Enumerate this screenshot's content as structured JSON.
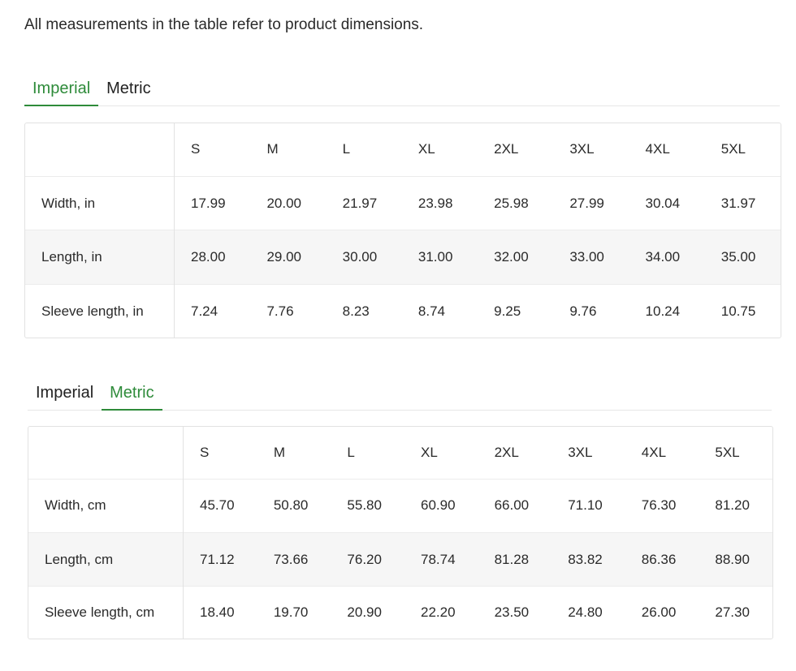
{
  "intro": "All measurements in the table refer to product dimensions.",
  "colors": {
    "accent": "#2e8b3a",
    "row_shade": "#f6f6f6",
    "border": "#e2e2e2"
  },
  "sizes": [
    "S",
    "M",
    "L",
    "XL",
    "2XL",
    "3XL",
    "4XL",
    "5XL"
  ],
  "imperial_section": {
    "tabs": [
      {
        "label": "Imperial",
        "active": true
      },
      {
        "label": "Metric",
        "active": false
      }
    ],
    "rows": [
      {
        "label": "Width, in",
        "values": [
          "17.99",
          "20.00",
          "21.97",
          "23.98",
          "25.98",
          "27.99",
          "30.04",
          "31.97"
        ]
      },
      {
        "label": "Length, in",
        "values": [
          "28.00",
          "29.00",
          "30.00",
          "31.00",
          "32.00",
          "33.00",
          "34.00",
          "35.00"
        ]
      },
      {
        "label": "Sleeve length, in",
        "values": [
          "7.24",
          "7.76",
          "8.23",
          "8.74",
          "9.25",
          "9.76",
          "10.24",
          "10.75"
        ]
      }
    ]
  },
  "metric_section": {
    "tabs": [
      {
        "label": "Imperial",
        "active": false
      },
      {
        "label": "Metric",
        "active": true
      }
    ],
    "rows": [
      {
        "label": "Width, cm",
        "values": [
          "45.70",
          "50.80",
          "55.80",
          "60.90",
          "66.00",
          "71.10",
          "76.30",
          "81.20"
        ]
      },
      {
        "label": "Length, cm",
        "values": [
          "71.12",
          "73.66",
          "76.20",
          "78.74",
          "81.28",
          "83.82",
          "86.36",
          "88.90"
        ]
      },
      {
        "label": "Sleeve length, cm",
        "values": [
          "18.40",
          "19.70",
          "20.90",
          "22.20",
          "23.50",
          "24.80",
          "26.00",
          "27.30"
        ]
      }
    ]
  }
}
